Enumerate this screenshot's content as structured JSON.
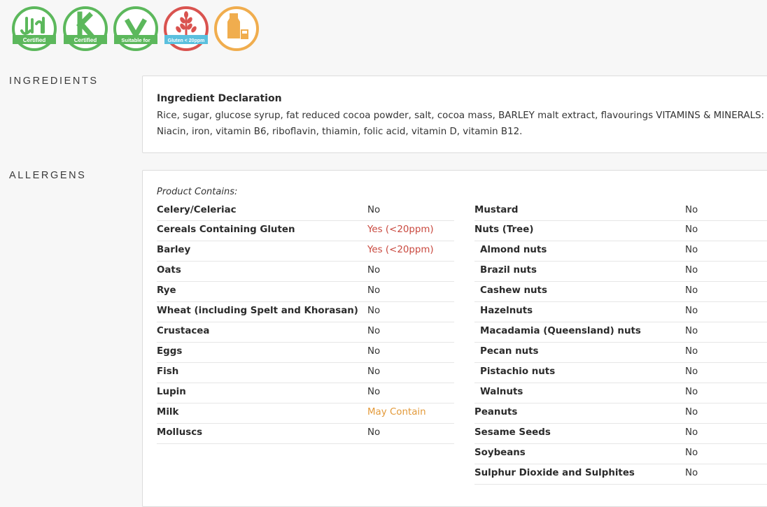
{
  "badges": [
    {
      "name": "halal-certified-badge",
      "label": "Certified",
      "color": "#5cb85c"
    },
    {
      "name": "kosher-certified-badge",
      "label": "Certified",
      "color": "#5cb85c"
    },
    {
      "name": "vegan-suitable-badge",
      "label": "Suitable for",
      "color": "#5cb85c"
    },
    {
      "name": "gluten-badge",
      "label": "Gluten < 20ppm",
      "color": "#d9534f",
      "label_bg": "#5bc0de"
    },
    {
      "name": "milk-badge",
      "label": "",
      "color": "#f0ad4e"
    }
  ],
  "ingredients": {
    "section_label": "INGREDIENTS",
    "title": "Ingredient Declaration",
    "text": "Rice, sugar, glucose syrup, fat reduced cocoa powder, salt, cocoa mass, BARLEY malt extract, flavourings VITAMINS & MINERALS: Niacin, iron, vitamin B6, riboflavin, thiamin, folic acid, vitamin D, vitamin B12."
  },
  "allergens": {
    "section_label": "ALLERGENS",
    "contains_label": "Product Contains:",
    "colors": {
      "no": "#333333",
      "yes": "#c9493f",
      "may": "#e39a3a"
    },
    "left": [
      {
        "name": "Celery/Celeriac",
        "value": "No",
        "status": "no"
      },
      {
        "name": "Cereals Containing Gluten",
        "value": "Yes (<20ppm)",
        "status": "yes"
      },
      {
        "name": "Barley",
        "value": "Yes (<20ppm)",
        "status": "yes"
      },
      {
        "name": "Oats",
        "value": "No",
        "status": "no"
      },
      {
        "name": "Rye",
        "value": "No",
        "status": "no"
      },
      {
        "name": "Wheat (including Spelt and Khorasan)",
        "value": "No",
        "status": "no"
      },
      {
        "name": "Crustacea",
        "value": "No",
        "status": "no"
      },
      {
        "name": "Eggs",
        "value": "No",
        "status": "no"
      },
      {
        "name": "Fish",
        "value": "No",
        "status": "no"
      },
      {
        "name": "Lupin",
        "value": "No",
        "status": "no"
      },
      {
        "name": "Milk",
        "value": "May Contain",
        "status": "may"
      },
      {
        "name": "Molluscs",
        "value": "No",
        "status": "no"
      }
    ],
    "right": [
      {
        "name": "Mustard",
        "value": "No",
        "status": "no",
        "sub": false
      },
      {
        "name": "Nuts (Tree)",
        "value": "No",
        "status": "no",
        "sub": false
      },
      {
        "name": "Almond nuts",
        "value": "No",
        "status": "no",
        "sub": true
      },
      {
        "name": "Brazil nuts",
        "value": "No",
        "status": "no",
        "sub": true
      },
      {
        "name": "Cashew nuts",
        "value": "No",
        "status": "no",
        "sub": true
      },
      {
        "name": "Hazelnuts",
        "value": "No",
        "status": "no",
        "sub": true
      },
      {
        "name": "Macadamia (Queensland) nuts",
        "value": "No",
        "status": "no",
        "sub": true
      },
      {
        "name": "Pecan nuts",
        "value": "No",
        "status": "no",
        "sub": true
      },
      {
        "name": "Pistachio nuts",
        "value": "No",
        "status": "no",
        "sub": true
      },
      {
        "name": "Walnuts",
        "value": "No",
        "status": "no",
        "sub": true
      },
      {
        "name": "Peanuts",
        "value": "No",
        "status": "no",
        "sub": false
      },
      {
        "name": "Sesame Seeds",
        "value": "No",
        "status": "no",
        "sub": false
      },
      {
        "name": "Soybeans",
        "value": "No",
        "status": "no",
        "sub": false
      },
      {
        "name": "Sulphur Dioxide and Sulphites",
        "value": "No",
        "status": "no",
        "sub": false
      }
    ]
  }
}
